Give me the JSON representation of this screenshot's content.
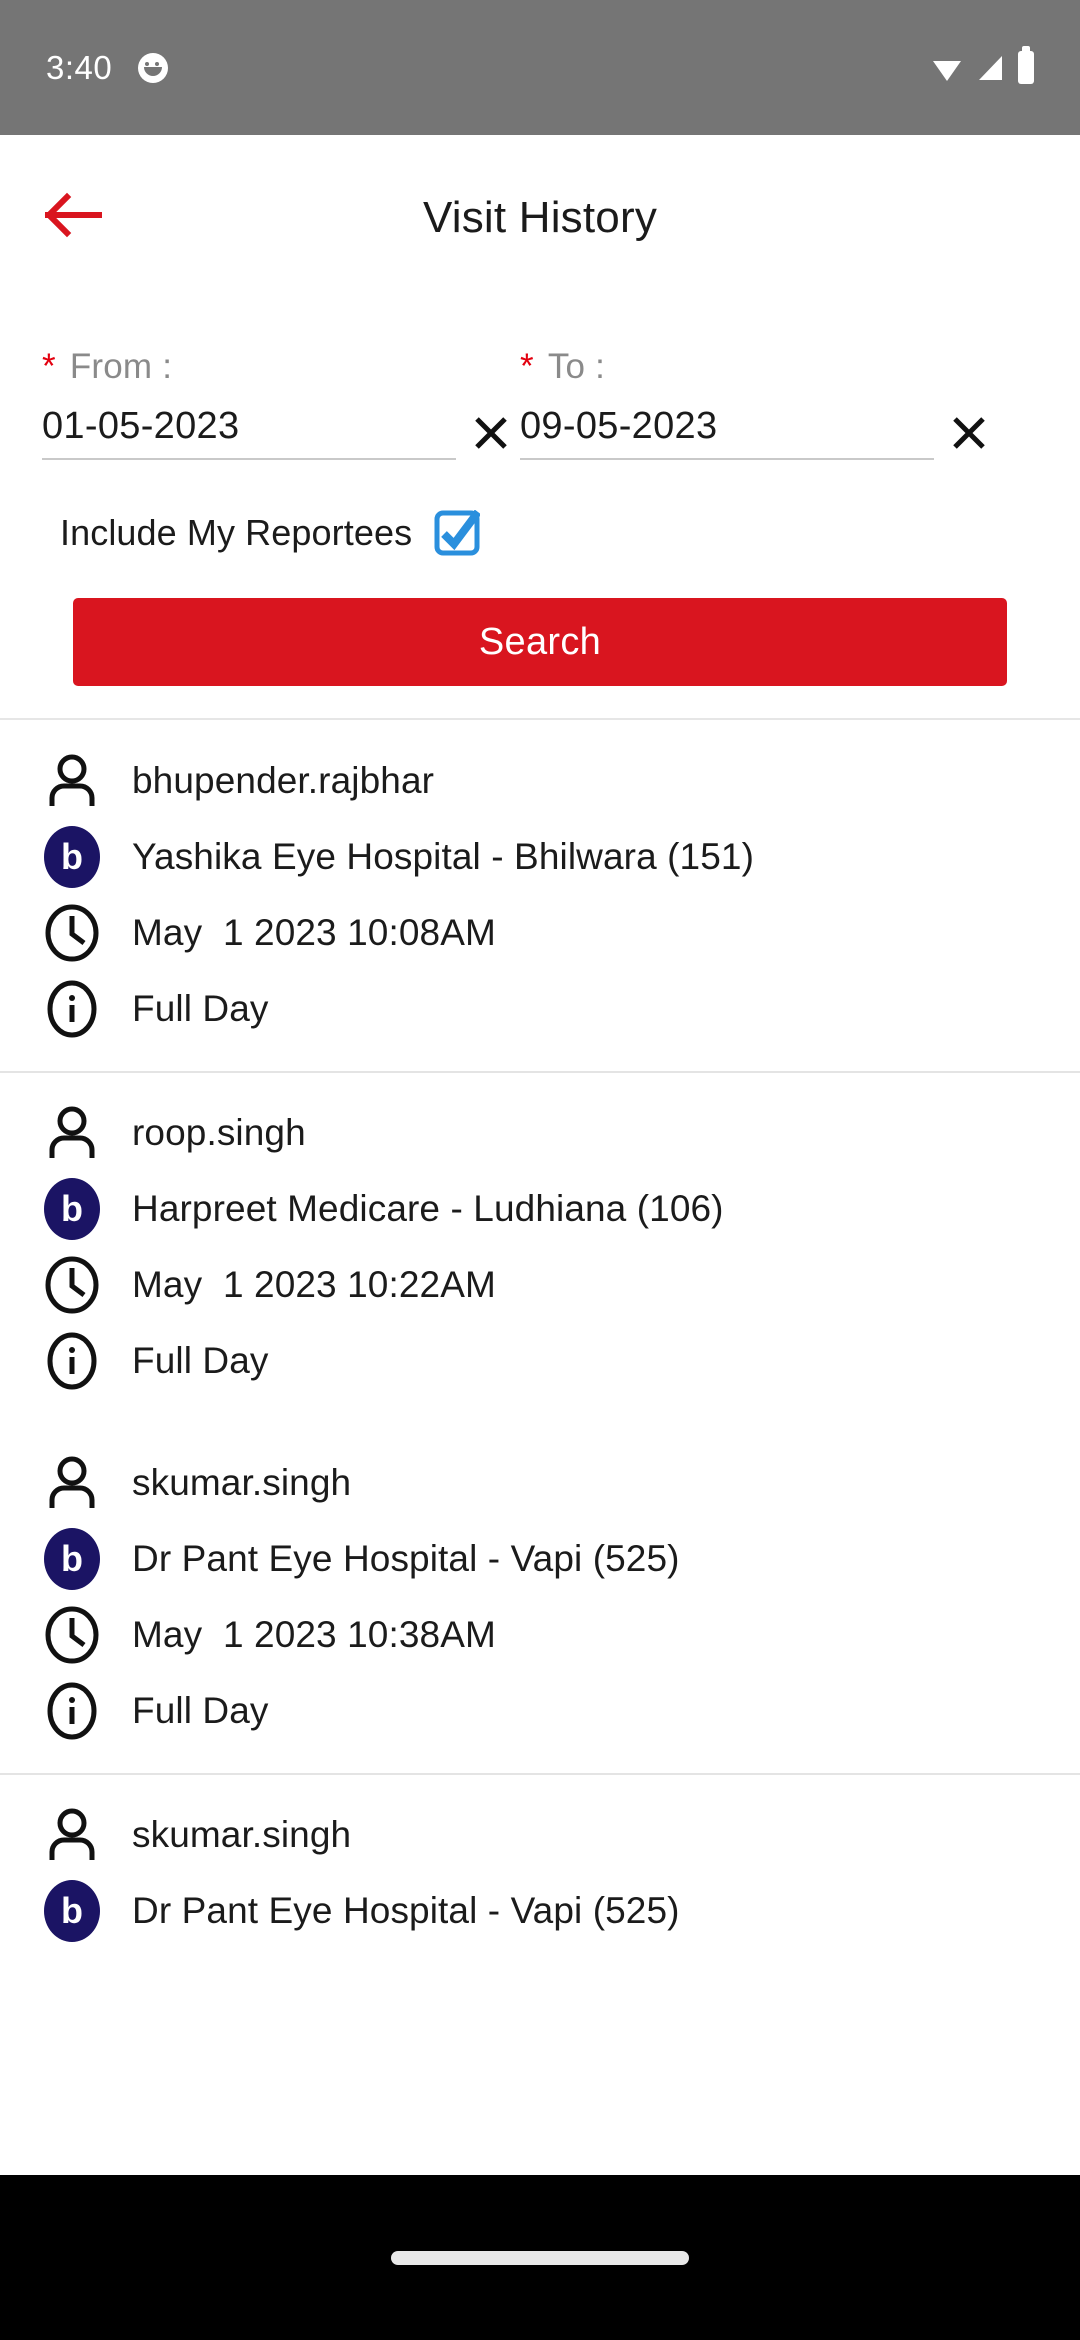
{
  "status_bar": {
    "time": "3:40",
    "app_icon": "app-notification-icon",
    "wifi_icon": "wifi-icon",
    "signal_icon": "cellular-signal-icon",
    "battery_icon": "battery-full-icon"
  },
  "app_bar": {
    "back_icon": "back-arrow-icon",
    "title": "Visit History",
    "accent_color": "#d9151f"
  },
  "filter": {
    "from": {
      "required_mark": "*",
      "label": "From :",
      "value": "01-05-2023",
      "placeholder": "DD-MM-YYYY",
      "clear_icon": "close-icon"
    },
    "to": {
      "required_mark": "*",
      "label": "To :",
      "value": "09-05-2023",
      "placeholder": "DD-MM-YYYY",
      "clear_icon": "close-icon"
    },
    "checkbox": {
      "label": "Include My Reportees",
      "checked": true,
      "color": "#2a8fdd"
    },
    "search_button": {
      "label": "Search",
      "color": "#d9151f"
    }
  },
  "results": {
    "badge_color": "#1b1464",
    "visits": [
      {
        "user": "bhupender.rajbhar",
        "account": "Yashika Eye Hospital - Bhilwara (151)",
        "timestamp": "May  1 2023 10:08AM",
        "duration": "Full Day"
      },
      {
        "user": "roop.singh",
        "account": "Harpreet Medicare - Ludhiana (106)",
        "timestamp": "May  1 2023 10:22AM",
        "duration": "Full Day"
      },
      {
        "user": "skumar.singh",
        "account": "Dr Pant Eye Hospital - Vapi (525)",
        "timestamp": "May  1 2023 10:38AM",
        "duration": "Full Day"
      },
      {
        "user": "skumar.singh",
        "account": "Dr Pant Eye Hospital - Vapi (525)",
        "timestamp": "",
        "duration": ""
      }
    ],
    "row_icons": {
      "user": "person-icon",
      "account": "account-badge-icon",
      "time": "clock-icon",
      "duration": "info-icon"
    }
  },
  "nav_bar": {
    "home_indicator": "home-indicator"
  }
}
